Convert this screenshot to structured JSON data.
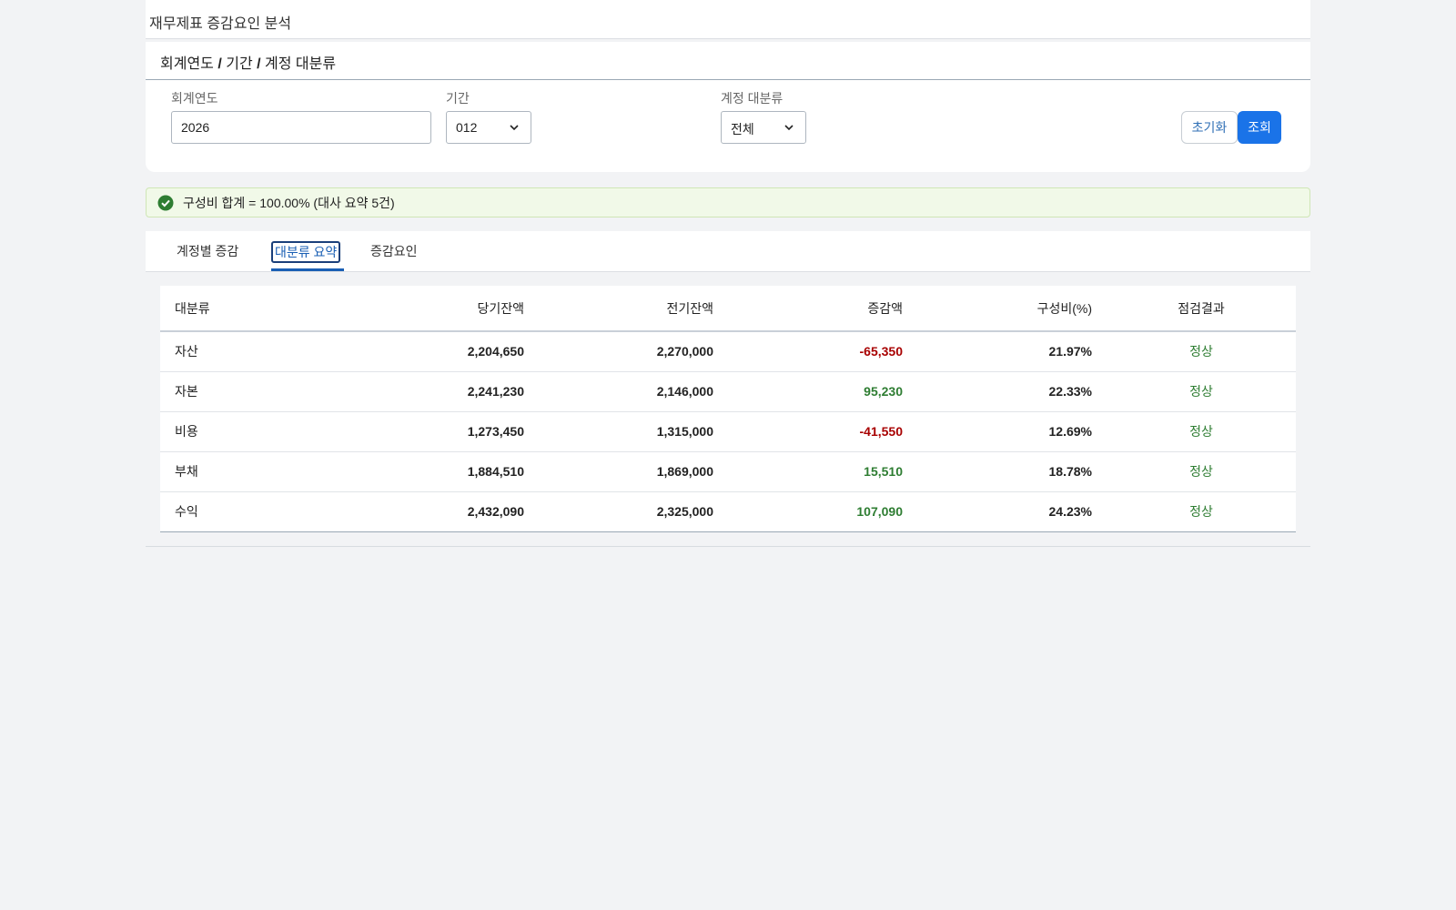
{
  "app": {
    "title": "재무제표 증감요인 분석"
  },
  "filter": {
    "heading_parts": [
      "회계연도",
      " / ",
      "기간",
      " / ",
      "계정 대분류"
    ],
    "fiscal_year": {
      "label": "회계연도",
      "value": "2026"
    },
    "period": {
      "label": "기간",
      "value": "012"
    },
    "category": {
      "label": "계정 대분류",
      "value": "전체"
    },
    "reset_label": "초기화",
    "search_label": "조회"
  },
  "alert": {
    "text": "구성비 합계 = 100.00% (대사 요약 5건)",
    "icon": "check-circle-icon"
  },
  "tabs": [
    {
      "label": "계정별 증감",
      "active": false
    },
    {
      "label": "대분류 요약",
      "active": true
    },
    {
      "label": "증감요인",
      "active": false
    }
  ],
  "table": {
    "headers": [
      "대분류",
      "당기잔액",
      "전기잔액",
      "증감액",
      "구성비(%)",
      "점검결과"
    ],
    "rows": [
      {
        "category": "자산",
        "current": "2,204,650",
        "previous": "2,270,000",
        "change": "-65,350",
        "ratio": "21.97%",
        "result": "정상"
      },
      {
        "category": "자본",
        "current": "2,241,230",
        "previous": "2,146,000",
        "change": "95,230",
        "ratio": "22.33%",
        "result": "정상"
      },
      {
        "category": "비용",
        "current": "1,273,450",
        "previous": "1,315,000",
        "change": "-41,550",
        "ratio": "12.69%",
        "result": "정상"
      },
      {
        "category": "부채",
        "current": "1,884,510",
        "previous": "1,869,000",
        "change": "15,510",
        "ratio": "18.78%",
        "result": "정상"
      },
      {
        "category": "수익",
        "current": "2,432,090",
        "previous": "2,325,000",
        "change": "107,090",
        "ratio": "24.23%",
        "result": "정상"
      }
    ]
  },
  "colors": {
    "accent": "#1a73e8",
    "negative": "#a80000",
    "positive": "#2e7d32",
    "alert_bg": "#f1f9e8"
  }
}
